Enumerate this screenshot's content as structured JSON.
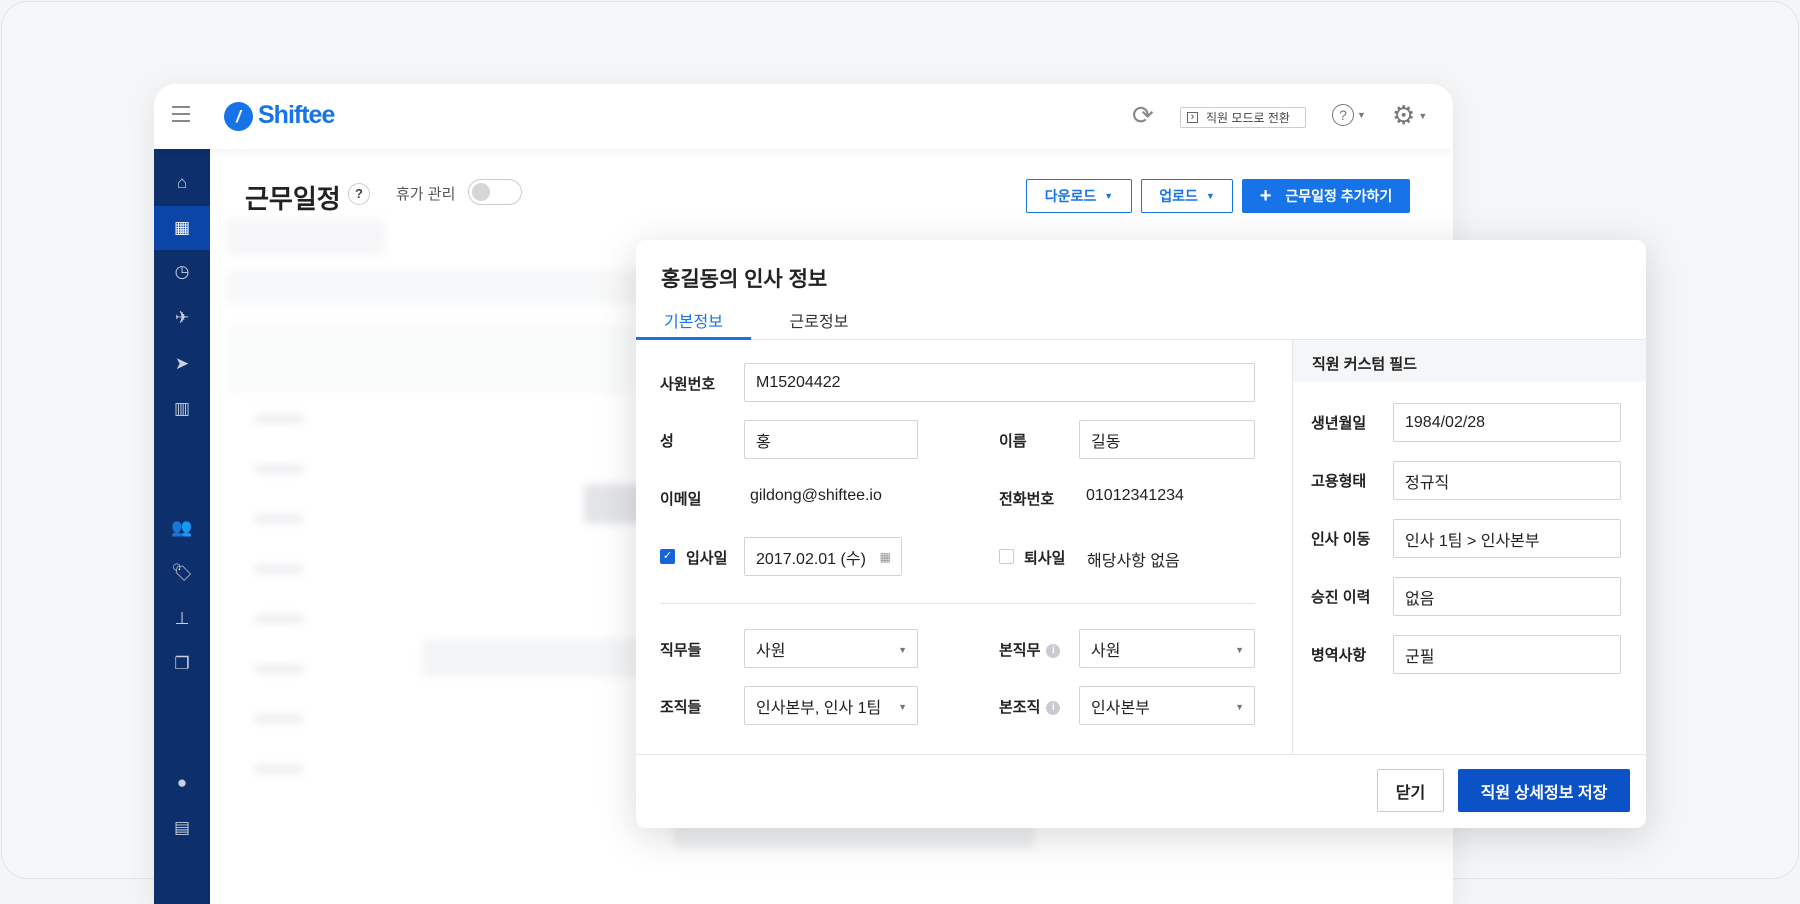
{
  "header": {
    "brand": "Shiftee",
    "switch_mode": "직원 모드로 전환"
  },
  "page": {
    "title": "근무일정",
    "help": "?",
    "leave_toggle_label": "휴가 관리",
    "download": "다운로드",
    "upload": "업로드",
    "add_schedule": "근무일정 추가하기",
    "add_icon": "+"
  },
  "sidebar": {
    "items": [
      "home-icon",
      "calendar-icon",
      "clock-icon",
      "plane-icon",
      "send-icon",
      "chart-icon",
      "users-icon",
      "tags-icon",
      "org-chart-icon",
      "copy-icon",
      "user-icon",
      "building-icon"
    ]
  },
  "modal": {
    "title": "홍길동의 인사 정보",
    "tabs": [
      "기본정보",
      "근로정보"
    ],
    "fields": {
      "employee_no_label": "사원번호",
      "employee_no": "M15204422",
      "last_name_label": "성",
      "last_name": "홍",
      "first_name_label": "이름",
      "first_name": "길동",
      "email_label": "이메일",
      "email": "gildong@shiftee.io",
      "phone_label": "전화번호",
      "phone": "01012341234",
      "hire_date_label": "입사일",
      "hire_date": "2017.02.01 (수)",
      "hire_checked": true,
      "leave_date_label": "퇴사일",
      "leave_date": "해당사항 없음",
      "leave_checked": false,
      "jobs_label": "직무들",
      "jobs": "사원",
      "main_job_label": "본직무",
      "main_job": "사원",
      "orgs_label": "조직들",
      "orgs": "인사본부, 인사 1팀",
      "main_org_label": "본조직",
      "main_org": "인사본부"
    },
    "custom": {
      "title": "직원 커스텀 필드",
      "rows": [
        {
          "label": "생년월일",
          "value": "1984/02/28"
        },
        {
          "label": "고용형태",
          "value": "정규직"
        },
        {
          "label": "인사 이동",
          "value": "인사 1팀 > 인사본부"
        },
        {
          "label": "승진 이력",
          "value": "없음"
        },
        {
          "label": "병역사항",
          "value": "군필"
        }
      ]
    },
    "close": "닫기",
    "save": "직원 상세정보 저장"
  },
  "colors": {
    "primary": "#1773e8",
    "sidebar": "#0d2f6b",
    "save": "#0b52c7"
  }
}
